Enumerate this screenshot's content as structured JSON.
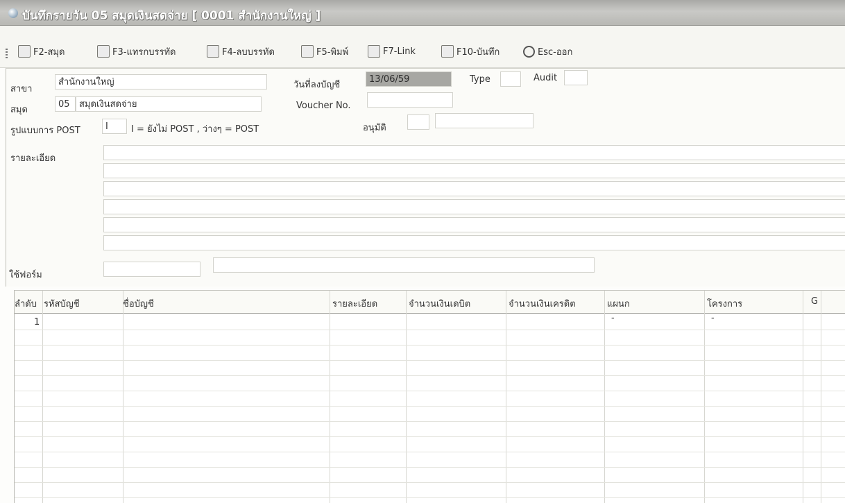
{
  "window": {
    "title": "บันทึกรายวัน 05 สมุดเงินสดจ่าย [ 0001 สำนักงานใหญ่ ]"
  },
  "toolbar": {
    "items": [
      {
        "label": "F2-สมุด",
        "icon": "book-icon"
      },
      {
        "label": "F3-แทรกบรรทัด",
        "icon": "insert-row-icon"
      },
      {
        "label": "F4-ลบบรรทัด",
        "icon": "delete-row-icon"
      },
      {
        "label": "F5-พิมพ์",
        "icon": "printer-icon"
      },
      {
        "label": "F7-Link",
        "icon": "link-icon"
      },
      {
        "label": "F10-บันทึก",
        "icon": "save-icon"
      },
      {
        "label": "Esc-ออก",
        "icon": "power-icon"
      }
    ]
  },
  "form": {
    "branch_label": "สาขา",
    "branch_value": "สำนักงานใหญ่",
    "book_label": "สมุด",
    "book_code": "05",
    "book_name": "สมุดเงินสดจ่าย",
    "post_label": "รูปแบบการ POST",
    "post_value": "I",
    "post_hint": "I = ยังไม่ POST , ว่างๆ = POST",
    "detail_label": "รายละเอียด",
    "form_label": "ใช้ฟอร์ม",
    "date_label": "วันที่ลงบัญชี",
    "date_value": "13/06/59",
    "type_label": "Type",
    "audit_label": "Audit",
    "voucher_label": "Voucher No.",
    "approve_label": "อนุมัติ"
  },
  "grid": {
    "columns": [
      "ลำดับ",
      "รหัสบัญชี",
      "ชื่อบัญชี",
      "รายละเอียด",
      "จำนวนเงินเดบิต",
      "จำนวนเงินเครดิต",
      "แผนก",
      "โครงการ",
      "G"
    ],
    "rows": [
      {
        "seq": "1",
        "dept": "-",
        "project": "-"
      }
    ]
  }
}
